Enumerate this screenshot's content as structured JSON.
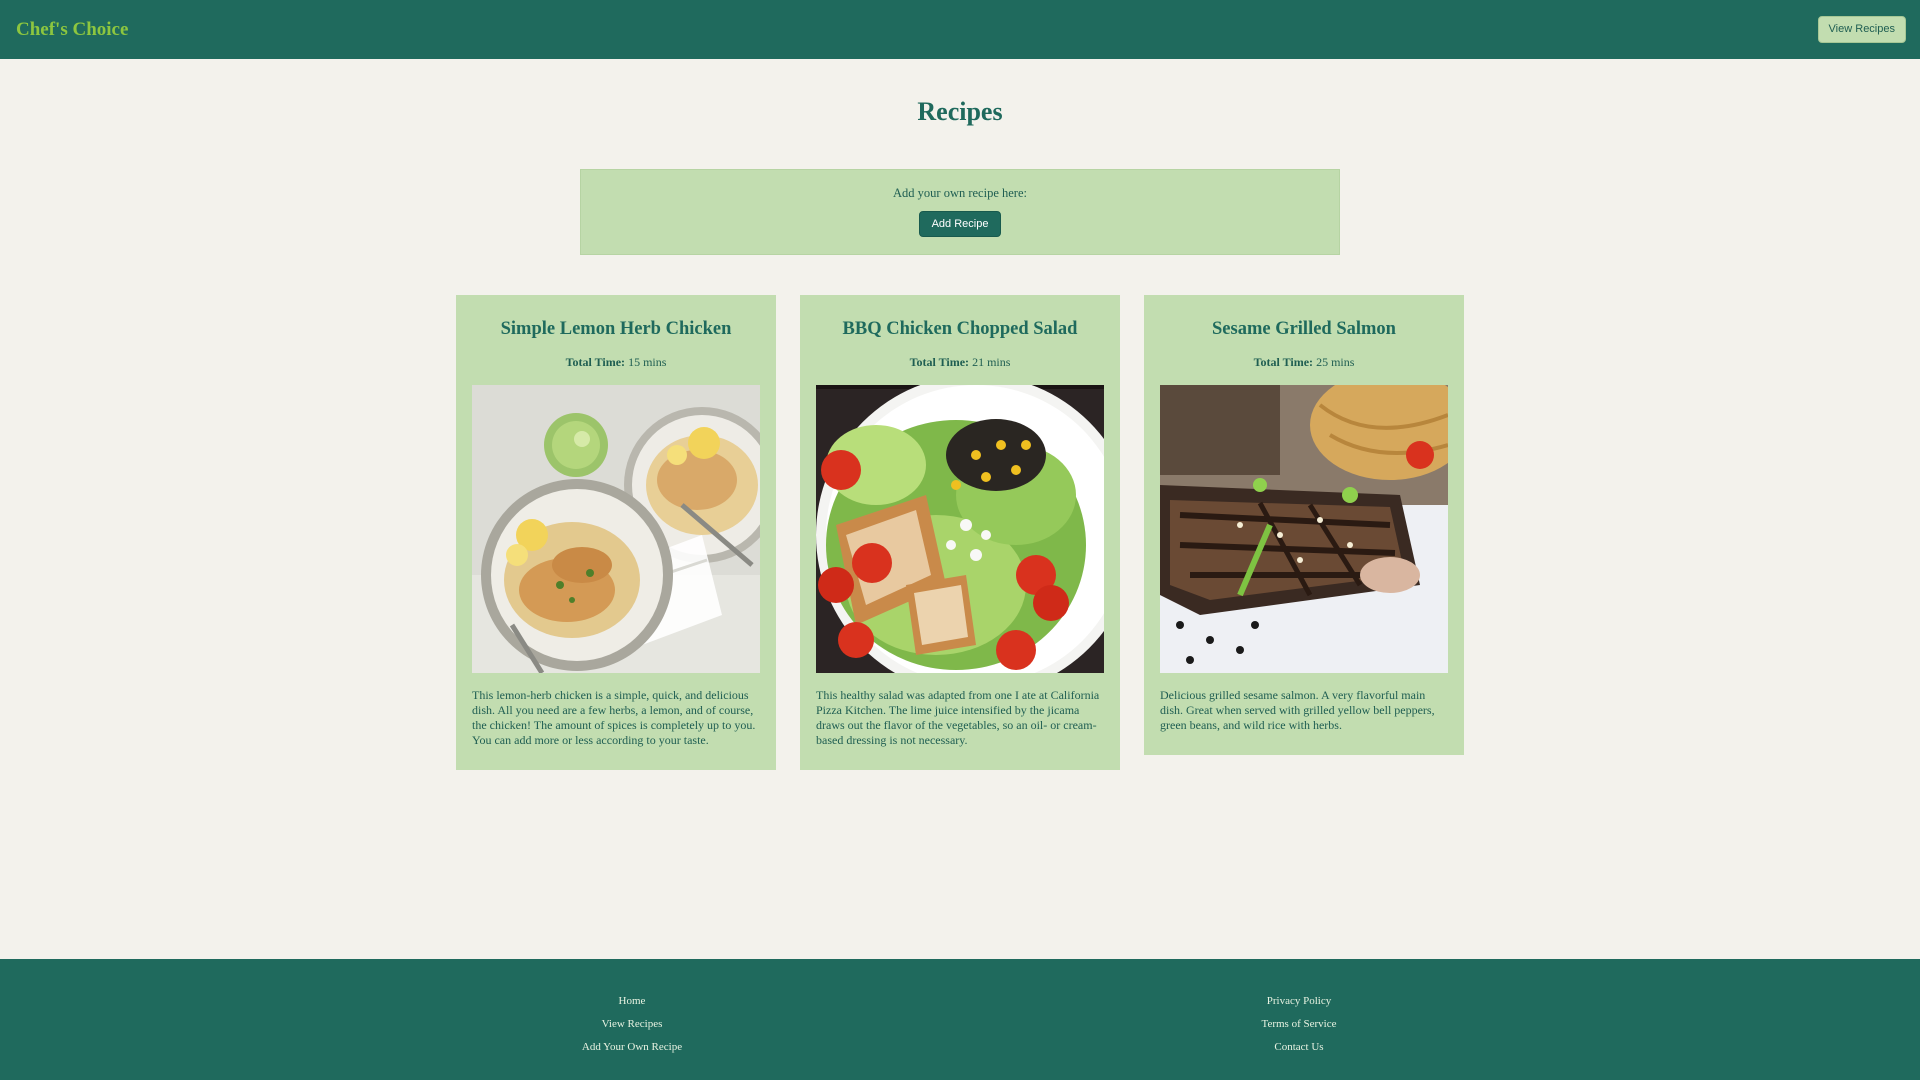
{
  "header": {
    "brand": "Chef's Choice",
    "view_recipes_label": "View Recipes"
  },
  "main": {
    "title": "Recipes",
    "add_prompt": "Add your own recipe here:",
    "add_button_label": "Add Recipe"
  },
  "recipes": [
    {
      "title": "Simple Lemon Herb Chicken",
      "time_label": "Total Time:",
      "time_value": "15 mins",
      "image": "lemon-herb-chicken-photo",
      "description": "This lemon-herb chicken is a simple, quick, and delicious dish. All you need are a few herbs, a lemon, and of course, the chicken! The amount of spices is completely up to you. You can add more or less according to your taste."
    },
    {
      "title": "BBQ Chicken Chopped Salad",
      "time_label": "Total Time:",
      "time_value": "21 mins",
      "image": "bbq-chicken-salad-photo",
      "description": "This healthy salad was adapted from one I ate at California Pizza Kitchen. The lime juice intensified by the jicama draws out the flavor of the vegetables, so an oil- or cream-based dressing is not necessary."
    },
    {
      "title": "Sesame Grilled Salmon",
      "time_label": "Total Time:",
      "time_value": "25 mins",
      "image": "sesame-grilled-salmon-photo",
      "description": "Delicious grilled sesame salmon. A very flavorful main dish. Great when served with grilled yellow bell peppers, green beans, and wild rice with herbs."
    }
  ],
  "footer": {
    "left_links": [
      "Home",
      "View Recipes",
      "Add Your Own Recipe"
    ],
    "right_links": [
      "Privacy Policy",
      "Terms of Service",
      "Contact Us"
    ]
  },
  "colors": {
    "header_bg": "#1f6a5d",
    "brand": "#8dc63f",
    "card_bg": "#c2ddb0",
    "page_bg": "#f3f2ec"
  }
}
